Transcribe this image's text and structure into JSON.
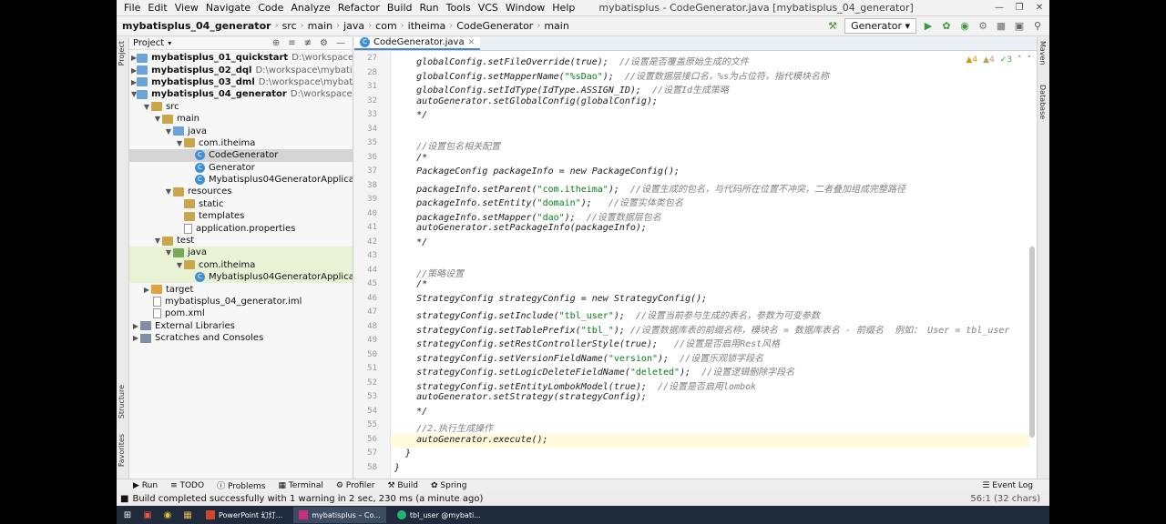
{
  "menu": {
    "items": [
      "File",
      "Edit",
      "View",
      "Navigate",
      "Code",
      "Analyze",
      "Refactor",
      "Build",
      "Run",
      "Tools",
      "VCS",
      "Window",
      "Help"
    ],
    "window_title": "mybatisplus - CodeGenerator.java [mybatisplus_04_generator]"
  },
  "breadcrumb": [
    "mybatisplus_04_generator",
    "src",
    "main",
    "java",
    "com",
    "itheima",
    "CodeGenerator",
    "main"
  ],
  "toolbar": {
    "run_config": "Generator"
  },
  "project": {
    "header": "Project",
    "nodes": [
      {
        "label": "mybatisplus_01_quickstart",
        "path": "D:\\workspace\\mybatisplus\\myb"
      },
      {
        "label": "mybatisplus_02_dql",
        "path": "D:\\workspace\\mybatisplus\\myb"
      },
      {
        "label": "mybatisplus_03_dml",
        "path": "D:\\workspace\\mybatisplus\\myb"
      },
      {
        "label": "mybatisplus_04_generator",
        "path": "D:\\workspace\\mybatisplus\\my"
      },
      {
        "label": "src"
      },
      {
        "label": "main"
      },
      {
        "label": "java"
      },
      {
        "label": "com.itheima"
      },
      {
        "label": "CodeGenerator"
      },
      {
        "label": "Generator"
      },
      {
        "label": "Mybatisplus04GeneratorApplication"
      },
      {
        "label": "resources"
      },
      {
        "label": "static"
      },
      {
        "label": "templates"
      },
      {
        "label": "application.properties"
      },
      {
        "label": "test"
      },
      {
        "label": "java"
      },
      {
        "label": "com.itheima"
      },
      {
        "label": "Mybatisplus04GeneratorApplicationTe"
      },
      {
        "label": "target"
      },
      {
        "label": "mybatisplus_04_generator.iml"
      },
      {
        "label": "pom.xml"
      },
      {
        "label": "External Libraries"
      },
      {
        "label": "Scratches and Consoles"
      }
    ]
  },
  "editor": {
    "tab": "CodeGenerator.java",
    "inspections": {
      "warnings": "4",
      "weak_warnings": "4",
      "ok": "3"
    },
    "lines": [
      {
        "n": "27",
        "code": "    globalConfig.setFileOverride(true);",
        "comment": "  //设置是否覆盖原始生成的文件"
      },
      {
        "n": "28",
        "code": "    globalConfig.setMapperName(",
        "str": "\"%sDao\"",
        "code2": ");",
        "comment": "  //设置数据层接口名，%s为占位符，指代模块名称"
      },
      {
        "n": "31",
        "code": "    globalConfig.setIdType(IdType.ASSIGN_ID);",
        "comment": "  //设置Id生成策略"
      },
      {
        "n": "32",
        "code": "    autoGenerator.setGlobalConfig(globalConfig);"
      },
      {
        "n": "33",
        "code": "    */"
      },
      {
        "n": "34",
        "code": ""
      },
      {
        "n": "35",
        "code": "",
        "comment": "    //设置包名相关配置"
      },
      {
        "n": "36",
        "code": "    /*"
      },
      {
        "n": "37",
        "code": "    PackageConfig packageInfo = new PackageConfig();"
      },
      {
        "n": "38",
        "code": "    packageInfo.setParent(",
        "str": "\"com.itheima\"",
        "code2": ");",
        "comment": "  //设置生成的包名，与代码所在位置不冲突，二者叠加组成完整路径"
      },
      {
        "n": "39",
        "code": "    packageInfo.setEntity(",
        "str": "\"domain\"",
        "code2": ");",
        "comment": "   //设置实体类包名"
      },
      {
        "n": "40",
        "code": "    packageInfo.setMapper(",
        "str": "\"dao\"",
        "code2": ");",
        "comment": "  //设置数据层包名"
      },
      {
        "n": "41",
        "code": "    autoGenerator.setPackageInfo(packageInfo);"
      },
      {
        "n": "42",
        "code": "    */"
      },
      {
        "n": "43",
        "code": ""
      },
      {
        "n": "44",
        "code": "",
        "comment": "    //策略设置"
      },
      {
        "n": "45",
        "code": "    /*"
      },
      {
        "n": "46",
        "code": "    StrategyConfig strategyConfig = new StrategyConfig();"
      },
      {
        "n": "47",
        "code": "    strategyConfig.setInclude(",
        "str": "\"tbl_user\"",
        "code2": ");",
        "comment": "  //设置当前参与生成的表名，参数为可变参数"
      },
      {
        "n": "48",
        "code": "    strategyConfig.setTablePrefix(",
        "str": "\"tbl_\"",
        "code2": ");",
        "comment": " //设置数据库表的前缀名称，模块名 = 数据库表名 - 前缀名  例如： User = tbl_user"
      },
      {
        "n": "49",
        "code": "    strategyConfig.setRestControllerStyle(true);",
        "comment": "   //设置是否启用Rest风格"
      },
      {
        "n": "50",
        "code": "    strategyConfig.setVersionFieldName(",
        "str": "\"version\"",
        "code2": ");",
        "comment": "  //设置乐观锁字段名"
      },
      {
        "n": "51",
        "code": "    strategyConfig.setLogicDeleteFieldName(",
        "str": "\"deleted\"",
        "code2": ");",
        "comment": "  //设置逻辑删除字段名"
      },
      {
        "n": "52",
        "code": "    strategyConfig.setEntityLombokModel(true);",
        "comment": "  //设置是否启用lombok"
      },
      {
        "n": "53",
        "code": "    autoGenerator.setStrategy(strategyConfig);"
      },
      {
        "n": "54",
        "code": "    */"
      },
      {
        "n": "55",
        "code": "",
        "comment": "    //2.执行生成操作"
      },
      {
        "n": "56",
        "code": "    autoGenerator.execute();"
      },
      {
        "n": "57",
        "code": "  }"
      },
      {
        "n": "58",
        "code": "}"
      }
    ]
  },
  "bottom_tabs": [
    "Run",
    "TODO",
    "Problems",
    "Terminal",
    "Profiler",
    "Build",
    "Spring"
  ],
  "event_log": "Event Log",
  "status": {
    "message": "Build completed successfully with 1 warning in 2 sec, 230 ms (a minute ago)",
    "position": "56:1 (32 chars)"
  },
  "taskbar": {
    "apps": [
      "PowerPoint 幻灯...",
      "mybatisplus – Co...",
      "tbl_user @mybati..."
    ]
  },
  "side_tabs": {
    "left": [
      "Project",
      "Structure",
      "Favorites"
    ],
    "right": [
      "Maven",
      "Database"
    ]
  }
}
